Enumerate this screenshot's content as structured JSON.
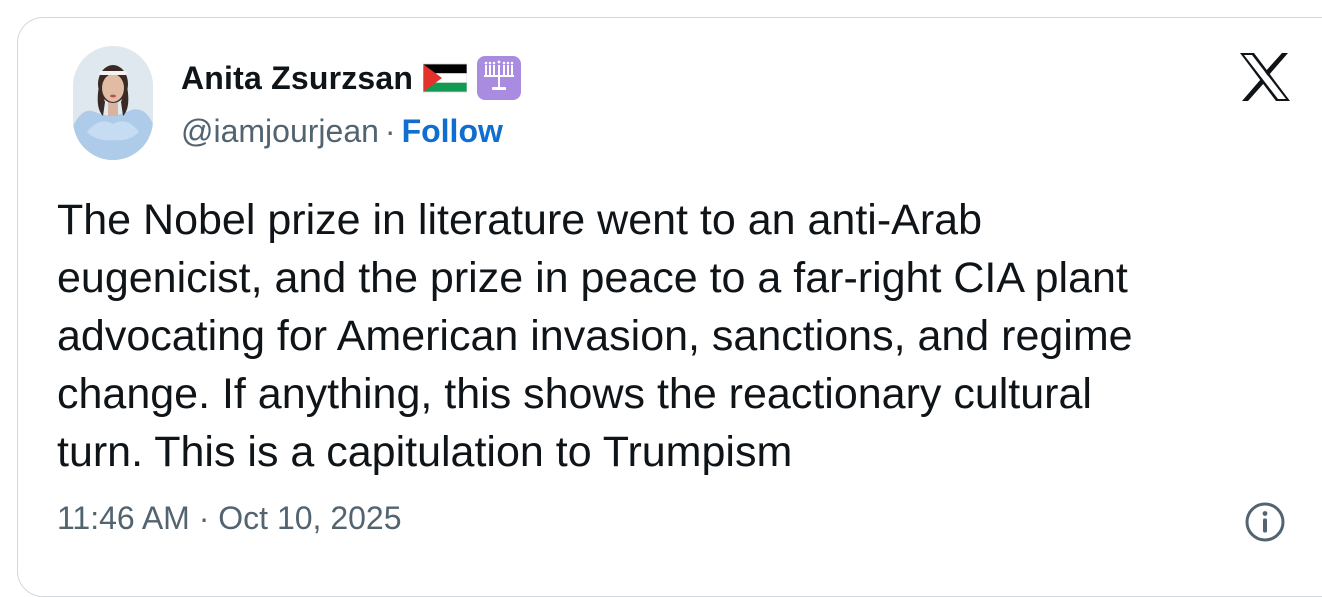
{
  "author": {
    "display_name": "Anita Zsurzsan",
    "handle": "@iamjourjean",
    "separator": "·",
    "follow_label": "Follow",
    "badges": [
      "palestine-flag-icon",
      "menorah-icon"
    ]
  },
  "tweet": {
    "text": "The Nobel prize in literature went to an anti-Arab\neugenicist, and the prize in peace to a far-right CIA plant\nadvocating for American invasion, sanctions, and regime\nchange. If anything, this shows the reactionary cultural\nturn. This is a capitulation to Trumpism",
    "timestamp": "11:46 AM · Oct 10, 2025"
  },
  "icons": {
    "platform_logo": "x-logo-icon",
    "info": "info-icon"
  },
  "colors": {
    "text_primary": "#0f1419",
    "text_secondary": "#536471",
    "link": "#0f6ecf",
    "border": "#cfd9de",
    "menorah_badge_bg": "#a98ce0"
  }
}
